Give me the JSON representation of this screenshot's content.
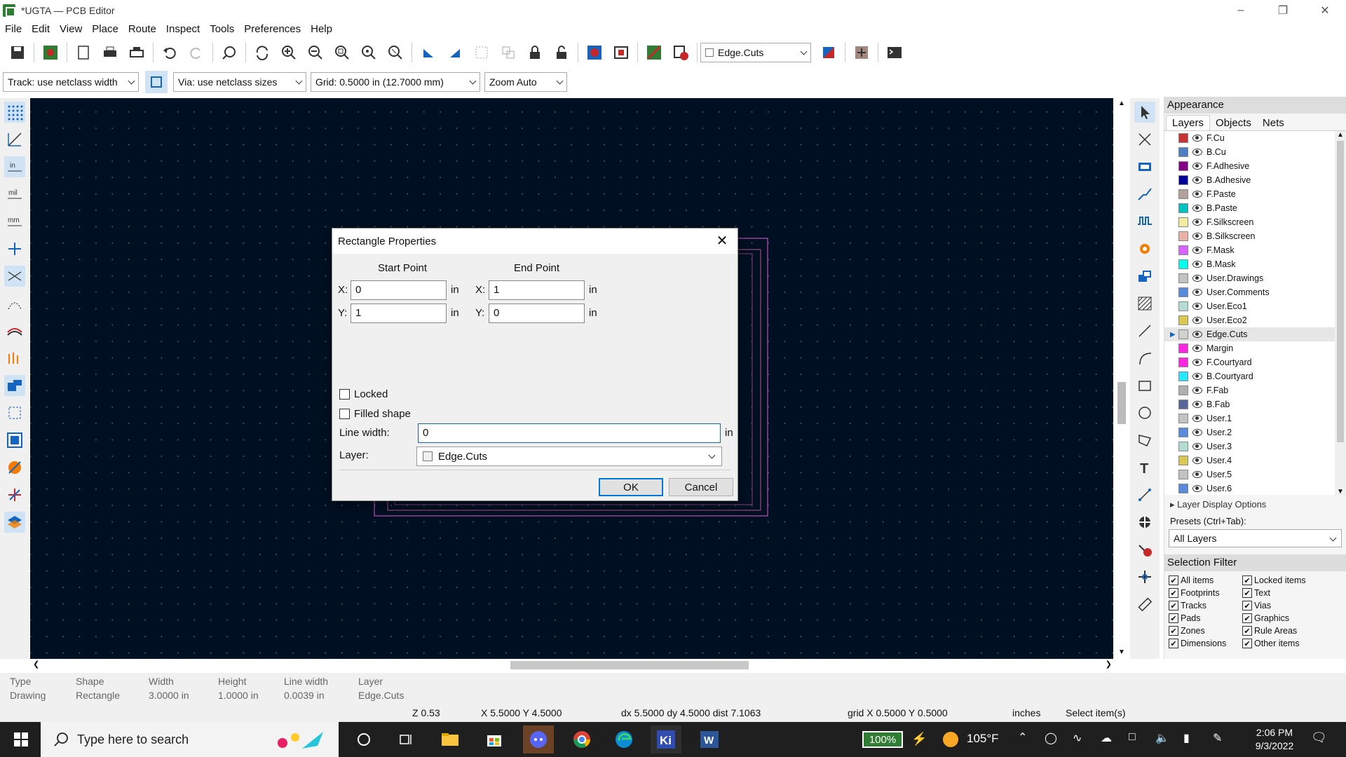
{
  "window": {
    "title": "*UGTA — PCB Editor"
  },
  "menu": [
    "File",
    "Edit",
    "View",
    "Place",
    "Route",
    "Inspect",
    "Tools",
    "Preferences",
    "Help"
  ],
  "toolbar": {
    "layer_select": "Edge.Cuts"
  },
  "toolbar2": {
    "track": "Track: use netclass width",
    "via": "Via: use netclass sizes",
    "grid": "Grid: 0.5000 in (12.7000 mm)",
    "zoom": "Zoom Auto"
  },
  "appearance": {
    "title": "Appearance",
    "tabs": [
      "Layers",
      "Objects",
      "Nets"
    ],
    "layers": [
      {
        "name": "F.Cu",
        "color": "#c83434"
      },
      {
        "name": "B.Cu",
        "color": "#4d7fc4"
      },
      {
        "name": "F.Adhesive",
        "color": "#84008a"
      },
      {
        "name": "B.Adhesive",
        "color": "#00009c"
      },
      {
        "name": "F.Paste",
        "color": "#b4a09a"
      },
      {
        "name": "B.Paste",
        "color": "#00c2c2"
      },
      {
        "name": "F.Silkscreen",
        "color": "#f2eda1"
      },
      {
        "name": "B.Silkscreen",
        "color": "#e8b2a7"
      },
      {
        "name": "F.Mask",
        "color": "#d864ff"
      },
      {
        "name": "B.Mask",
        "color": "#02ffee"
      },
      {
        "name": "User.Drawings",
        "color": "#c2c2c2"
      },
      {
        "name": "User.Comments",
        "color": "#5989db"
      },
      {
        "name": "User.Eco1",
        "color": "#b4dbd2"
      },
      {
        "name": "User.Eco2",
        "color": "#d8c852"
      },
      {
        "name": "Edge.Cuts",
        "color": "#d0d2cd"
      },
      {
        "name": "Margin",
        "color": "#ff26e2"
      },
      {
        "name": "F.Courtyard",
        "color": "#ff26e2"
      },
      {
        "name": "B.Courtyard",
        "color": "#26e9ff"
      },
      {
        "name": "F.Fab",
        "color": "#afafaf"
      },
      {
        "name": "B.Fab",
        "color": "#58659b"
      },
      {
        "name": "User.1",
        "color": "#c2c2c2"
      },
      {
        "name": "User.2",
        "color": "#5989db"
      },
      {
        "name": "User.3",
        "color": "#b4dbd2"
      },
      {
        "name": "User.4",
        "color": "#d8c852"
      },
      {
        "name": "User.5",
        "color": "#c2c2c2"
      },
      {
        "name": "User.6",
        "color": "#5989db"
      }
    ],
    "current_layer": "Edge.Cuts",
    "layer_display_options": "Layer Display Options",
    "presets_label": "Presets (Ctrl+Tab):",
    "preset_value": "All Layers"
  },
  "selection_filter": {
    "title": "Selection Filter",
    "items": [
      "All items",
      "Locked items",
      "Footprints",
      "Text",
      "Tracks",
      "Vias",
      "Pads",
      "Graphics",
      "Zones",
      "Rule Areas",
      "Dimensions",
      "Other items"
    ]
  },
  "message_panel": [
    {
      "label": "Type",
      "value": "Drawing"
    },
    {
      "label": "Shape",
      "value": "Rectangle"
    },
    {
      "label": "Width",
      "value": "3.0000 in"
    },
    {
      "label": "Height",
      "value": "1.0000 in"
    },
    {
      "label": "Line width",
      "value": "0.0039 in"
    },
    {
      "label": "Layer",
      "value": "Edge.Cuts"
    }
  ],
  "status": {
    "zoom": "Z 0.53",
    "xy": "X 5.5000  Y 4.5000",
    "dxy": "dx 5.5000  dy 4.5000  dist 7.1063",
    "grid": "grid X 0.5000  Y 0.5000",
    "units": "inches",
    "mode": "Select item(s)"
  },
  "dialog": {
    "title": "Rectangle Properties",
    "start_point": "Start Point",
    "end_point": "End Point",
    "start_x": "0",
    "start_y": "1",
    "end_x": "1",
    "end_y": "0",
    "unit": "in",
    "x_label": "X:",
    "y_label": "Y:",
    "locked": "Locked",
    "filled": "Filled shape",
    "line_width_label": "Line width:",
    "line_width": "0",
    "layer_label": "Layer:",
    "layer": "Edge.Cuts",
    "ok": "OK",
    "cancel": "Cancel"
  },
  "taskbar": {
    "search": "Type here to search",
    "battery": "100%",
    "temp": "105°F",
    "time": "2:06 PM",
    "date": "9/3/2022"
  }
}
